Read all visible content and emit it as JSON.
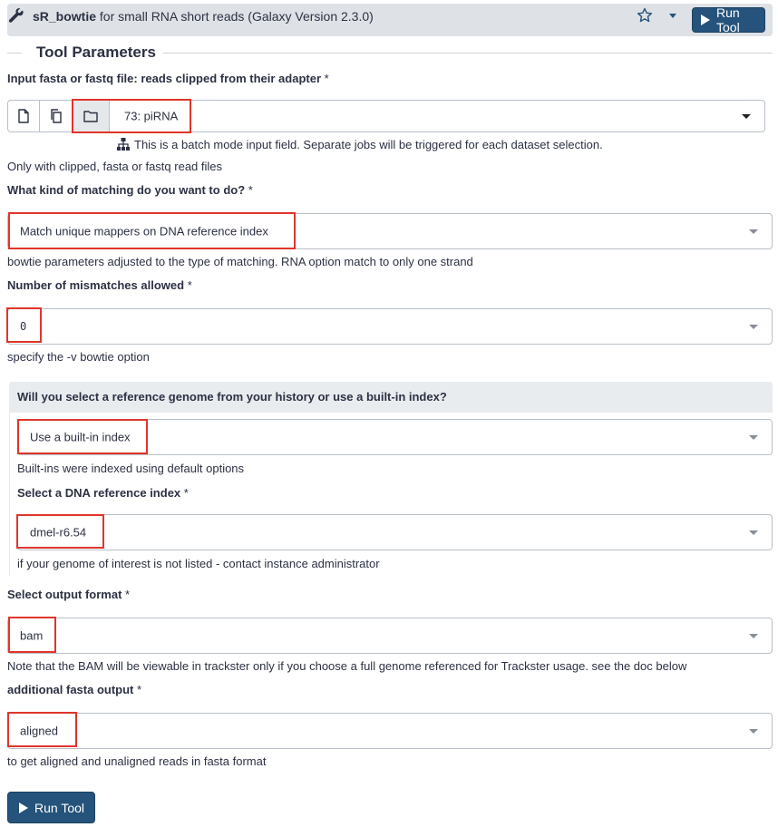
{
  "header": {
    "tool_name": "sR_bowtie",
    "tool_description": "for small RNA short reads (Galaxy Version 2.3.0)",
    "run_label": "Run Tool",
    "icons": {
      "wrench": "wrench-icon",
      "star": "star-icon",
      "dropdown": "caret-down-icon",
      "run": "play-icon"
    }
  },
  "section": {
    "title": "Tool Parameters"
  },
  "input_file": {
    "label": "Input fasta or fastq file: reads clipped from their adapter",
    "required_mark": "*",
    "value": "73: piRNA",
    "batch_note": "This is a batch mode input field. Separate jobs will be triggered for each dataset selection.",
    "help": "Only with clipped, fasta or fastq read files",
    "icons": [
      "file-icon",
      "copy-icon",
      "folder-icon",
      "sitemap-icon"
    ]
  },
  "matching": {
    "label": "What kind of matching do you want to do?",
    "required_mark": "*",
    "value": "Match unique mappers on DNA reference index",
    "help": "bowtie parameters adjusted to the type of matching. RNA option match to only one strand"
  },
  "mismatches": {
    "label": "Number of mismatches allowed",
    "required_mark": "*",
    "value": "0",
    "help": "specify the -v bowtie option"
  },
  "reference": {
    "label": "Will you select a reference genome from your history or use a built-in index?",
    "value": "Use a built-in index",
    "help": "Built-ins were indexed using default options",
    "index_label": "Select a DNA reference index",
    "index_required_mark": "*",
    "index_value": "dmel-r6.54",
    "index_help": "if your genome of interest is not listed - contact instance administrator"
  },
  "output_format": {
    "label": "Select output format",
    "required_mark": "*",
    "value": "bam",
    "help": "Note that the BAM will be viewable in trackster only if you choose a full genome referenced for Trackster usage. see the doc below"
  },
  "fasta_output": {
    "label": "additional fasta output",
    "required_mark": "*",
    "value": "aligned",
    "help": "to get aligned and unaligned reads in fasta format"
  },
  "footer": {
    "run_label": "Run Tool"
  },
  "colors": {
    "primary": "#25537b",
    "highlight": "#e0352b",
    "header_bg": "#dee2e6"
  }
}
